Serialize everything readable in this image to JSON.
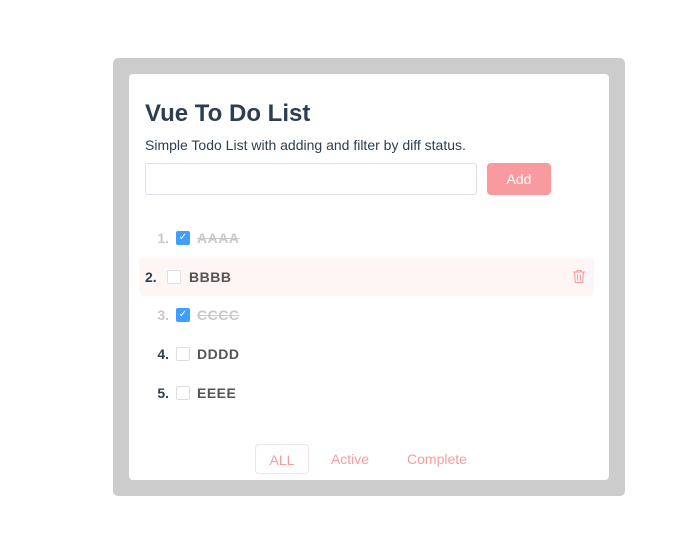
{
  "app": {
    "title": "Vue To Do List",
    "subtitle": "Simple Todo List with adding and filter by diff status.",
    "input_value": "",
    "add_label": "Add"
  },
  "todos": [
    {
      "number": "1.",
      "text": "AAAA",
      "done": true
    },
    {
      "number": "2.",
      "text": "BBBB",
      "done": false,
      "hovered": true
    },
    {
      "number": "3.",
      "text": "CCCC",
      "done": true
    },
    {
      "number": "4.",
      "text": "DDDD",
      "done": false
    },
    {
      "number": "5.",
      "text": "EEEE",
      "done": false
    }
  ],
  "filters": [
    {
      "label": "ALL",
      "active": true
    },
    {
      "label": "Active",
      "active": false
    },
    {
      "label": "Complete",
      "active": false
    }
  ],
  "icons": {
    "check": "checkmark-icon",
    "delete": "trash-icon"
  },
  "colors": {
    "accent": "#f99b9e",
    "checkbox": "#409eff",
    "frame": "#cccccc",
    "done_text": "#c9c9c9"
  }
}
